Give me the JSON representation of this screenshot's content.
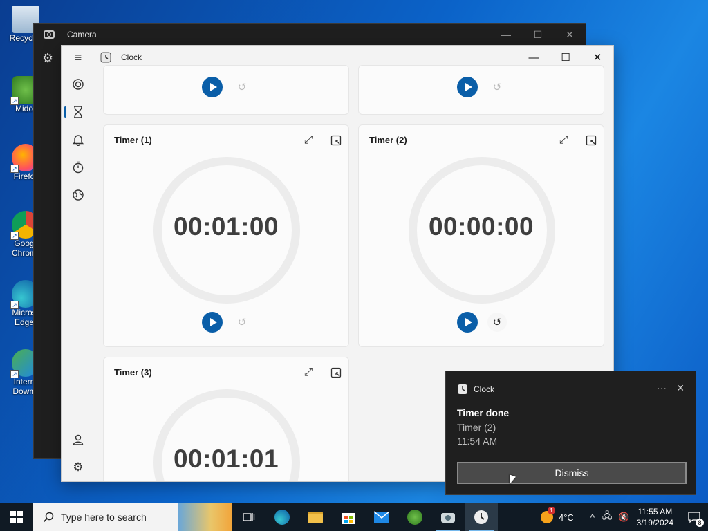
{
  "desktop": {
    "icons": [
      {
        "label": "Recycle"
      },
      {
        "label": "Mido"
      },
      {
        "label": "Firefo"
      },
      {
        "label": "Goog\nChrom"
      },
      {
        "label": "Micros\nEdge"
      },
      {
        "label": "Intern\nDownl"
      }
    ]
  },
  "camera_window": {
    "title": "Camera",
    "controls": {
      "minimize": "—",
      "maximize": "☐",
      "close": "✕"
    }
  },
  "clock_window": {
    "title": "Clock",
    "controls": {
      "minimize": "—",
      "maximize": "☐",
      "close": "✕"
    },
    "nav": [
      "focus-sessions",
      "timer",
      "alarm",
      "stopwatch",
      "world-clock"
    ],
    "active_nav": "timer",
    "timers": [
      {
        "name": "Timer (1)",
        "time": "00:01:00",
        "reset_enabled": false
      },
      {
        "name": "Timer (2)",
        "time": "00:00:00",
        "reset_enabled": true
      },
      {
        "name": "Timer (3)",
        "time": "00:01:01",
        "reset_enabled": false
      }
    ]
  },
  "toast": {
    "app_name": "Clock",
    "more": "···",
    "close": "✕",
    "title": "Timer done",
    "subtitle": "Timer (2)",
    "time": "11:54 AM",
    "dismiss_label": "Dismiss"
  },
  "taskbar": {
    "search_placeholder": "Type here to search",
    "weather": "4°C",
    "clock_time": "11:55 AM",
    "clock_date": "3/19/2024",
    "notification_count": "8",
    "weather_badge": "1"
  },
  "colors": {
    "accent": "#0a5ea8",
    "taskbar": "#101a24",
    "toast_bg": "#1f1f1f"
  }
}
